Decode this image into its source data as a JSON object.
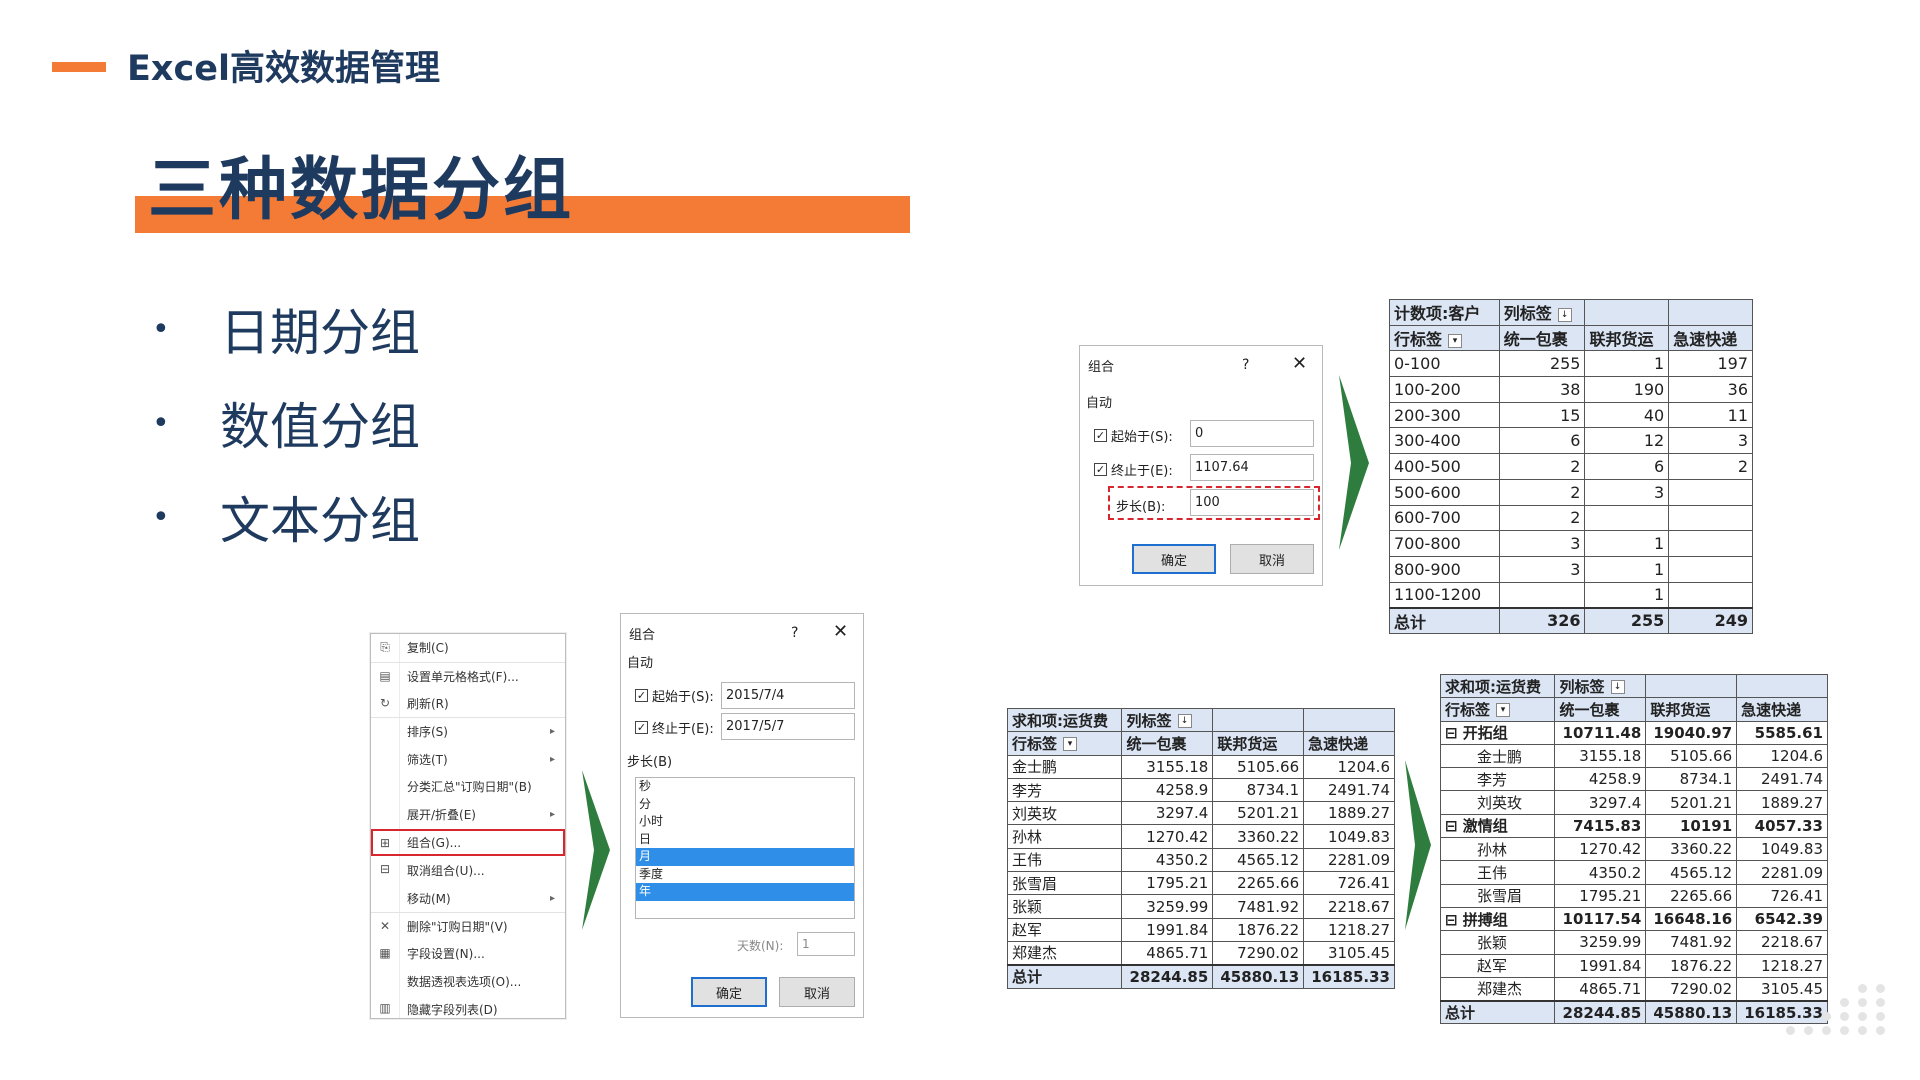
{
  "header": {
    "course": "Excel高效数据管理"
  },
  "title": "三种数据分组",
  "bullets": [
    "日期分组",
    "数值分组",
    "文本分组"
  ],
  "context_menu": {
    "items": [
      {
        "label": "复制(C)",
        "icon": "copy-icon"
      },
      {
        "label": "设置单元格格式(F)...",
        "icon": "format-cells-icon"
      },
      {
        "label": "刷新(R)",
        "icon": "refresh-icon"
      },
      {
        "label": "排序(S)",
        "icon": "",
        "submenu": true
      },
      {
        "label": "筛选(T)",
        "icon": "",
        "submenu": true
      },
      {
        "label": "分类汇总\"订购日期\"(B)",
        "icon": ""
      },
      {
        "label": "展开/折叠(E)",
        "icon": "",
        "submenu": true
      },
      {
        "label": "组合(G)...",
        "icon": "group-icon",
        "highlighted": true
      },
      {
        "label": "取消组合(U)...",
        "icon": "ungroup-icon"
      },
      {
        "label": "移动(M)",
        "icon": "",
        "submenu": true
      },
      {
        "label": "删除\"订购日期\"(V)",
        "icon": "delete-icon"
      },
      {
        "label": "字段设置(N)...",
        "icon": "field-settings-icon"
      },
      {
        "label": "数据透视表选项(O)...",
        "icon": ""
      },
      {
        "label": "隐藏字段列表(D)",
        "icon": "field-list-icon"
      }
    ]
  },
  "date_dialog": {
    "title": "组合",
    "help": "?",
    "close": "✕",
    "section": "自动",
    "start_label": "起始于(S):",
    "start_value": "2015/7/4",
    "end_label": "终止于(E):",
    "end_value": "2017/5/7",
    "step_label": "步长(B)",
    "step_options": [
      {
        "label": "秒",
        "selected": false
      },
      {
        "label": "分",
        "selected": false
      },
      {
        "label": "小时",
        "selected": false
      },
      {
        "label": "日",
        "selected": false
      },
      {
        "label": "月",
        "selected": true
      },
      {
        "label": "季度",
        "selected": false
      },
      {
        "label": "年",
        "selected": true
      }
    ],
    "days_label": "天数(N):",
    "days_value": "1",
    "ok": "确定",
    "cancel": "取消"
  },
  "number_dialog": {
    "title": "组合",
    "help": "?",
    "close": "✕",
    "section": "自动",
    "start_label": "起始于(S):",
    "start_value": "0",
    "end_label": "终止于(E):",
    "end_value": "1107.64",
    "step_label": "步长(B):",
    "step_value": "100",
    "ok": "确定",
    "cancel": "取消"
  },
  "count_table": {
    "corner": "计数项:客户",
    "col_label": "列标签",
    "row_label": "行标签",
    "columns": [
      "统一包裹",
      "联邦货运",
      "急速快递"
    ],
    "rows": [
      {
        "label": "0-100",
        "values": [
          "255",
          "1",
          "197"
        ]
      },
      {
        "label": "100-200",
        "values": [
          "38",
          "190",
          "36"
        ]
      },
      {
        "label": "200-300",
        "values": [
          "15",
          "40",
          "11"
        ]
      },
      {
        "label": "300-400",
        "values": [
          "6",
          "12",
          "3"
        ]
      },
      {
        "label": "400-500",
        "values": [
          "2",
          "6",
          "2"
        ]
      },
      {
        "label": "500-600",
        "values": [
          "2",
          "3",
          ""
        ]
      },
      {
        "label": "600-700",
        "values": [
          "2",
          "",
          ""
        ]
      },
      {
        "label": "700-800",
        "values": [
          "3",
          "1",
          ""
        ]
      },
      {
        "label": "800-900",
        "values": [
          "3",
          "1",
          ""
        ]
      },
      {
        "label": "1100-1200",
        "values": [
          "",
          "1",
          ""
        ]
      }
    ],
    "total": {
      "label": "总计",
      "values": [
        "326",
        "255",
        "249"
      ]
    }
  },
  "sum_table": {
    "corner": "求和项:运货费",
    "col_label": "列标签",
    "row_label": "行标签",
    "columns": [
      "统一包裹",
      "联邦货运",
      "急速快递"
    ],
    "rows": [
      {
        "label": "金士鹏",
        "values": [
          "3155.18",
          "5105.66",
          "1204.6"
        ]
      },
      {
        "label": "李芳",
        "values": [
          "4258.9",
          "8734.1",
          "2491.74"
        ]
      },
      {
        "label": "刘英玫",
        "values": [
          "3297.4",
          "5201.21",
          "1889.27"
        ]
      },
      {
        "label": "孙林",
        "values": [
          "1270.42",
          "3360.22",
          "1049.83"
        ]
      },
      {
        "label": "王伟",
        "values": [
          "4350.2",
          "4565.12",
          "2281.09"
        ]
      },
      {
        "label": "张雪眉",
        "values": [
          "1795.21",
          "2265.66",
          "726.41"
        ]
      },
      {
        "label": "张颖",
        "values": [
          "3259.99",
          "7481.92",
          "2218.67"
        ]
      },
      {
        "label": "赵军",
        "values": [
          "1991.84",
          "1876.22",
          "1218.27"
        ]
      },
      {
        "label": "郑建杰",
        "values": [
          "4865.71",
          "7290.02",
          "3105.45"
        ]
      }
    ],
    "total": {
      "label": "总计",
      "values": [
        "28244.85",
        "45880.13",
        "16185.33"
      ]
    }
  },
  "grouped_table": {
    "corner": "求和项:运货费",
    "col_label": "列标签",
    "row_label": "行标签",
    "columns": [
      "统一包裹",
      "联邦货运",
      "急速快递"
    ],
    "rows": [
      {
        "label": "开拓组",
        "group": true,
        "values": [
          "10711.48",
          "19040.97",
          "5585.61"
        ]
      },
      {
        "label": "金士鹏",
        "values": [
          "3155.18",
          "5105.66",
          "1204.6"
        ]
      },
      {
        "label": "李芳",
        "values": [
          "4258.9",
          "8734.1",
          "2491.74"
        ]
      },
      {
        "label": "刘英玫",
        "values": [
          "3297.4",
          "5201.21",
          "1889.27"
        ]
      },
      {
        "label": "激情组",
        "group": true,
        "values": [
          "7415.83",
          "10191",
          "4057.33"
        ]
      },
      {
        "label": "孙林",
        "values": [
          "1270.42",
          "3360.22",
          "1049.83"
        ]
      },
      {
        "label": "王伟",
        "values": [
          "4350.2",
          "4565.12",
          "2281.09"
        ]
      },
      {
        "label": "张雪眉",
        "values": [
          "1795.21",
          "2265.66",
          "726.41"
        ]
      },
      {
        "label": "拼搏组",
        "group": true,
        "values": [
          "10117.54",
          "16648.16",
          "6542.39"
        ]
      },
      {
        "label": "张颖",
        "values": [
          "3259.99",
          "7481.92",
          "2218.67"
        ]
      },
      {
        "label": "赵军",
        "values": [
          "1991.84",
          "1876.22",
          "1218.27"
        ]
      },
      {
        "label": "郑建杰",
        "values": [
          "4865.71",
          "7290.02",
          "3105.45"
        ]
      }
    ],
    "total": {
      "label": "总计",
      "values": [
        "28244.85",
        "45880.13",
        "16185.33"
      ]
    }
  },
  "colors": {
    "accent": "#f47b35",
    "navy": "#1f3a5f",
    "arrow": "#2e7d3e",
    "highlight": "#d7262e",
    "table_header": "#dbe5f4"
  }
}
